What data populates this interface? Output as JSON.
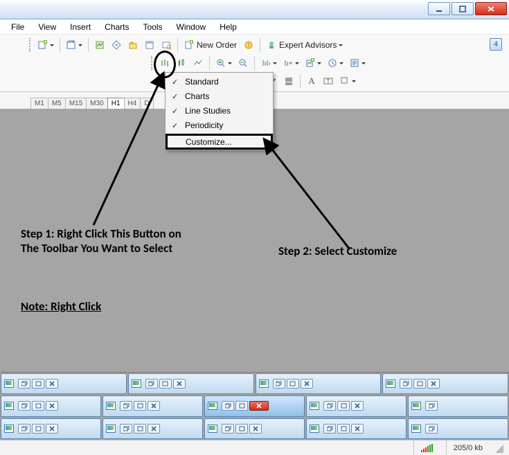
{
  "window_controls": {
    "minimize": "–",
    "maximize": "▢",
    "close": "✕"
  },
  "menu": [
    "File",
    "View",
    "Insert",
    "Charts",
    "Tools",
    "Window",
    "Help"
  ],
  "toolbar1": {
    "new_order": "New Order",
    "expert_advisors": "Expert Advisors",
    "badge": "4"
  },
  "context_menu": {
    "items": [
      {
        "label": "Standard",
        "checked": true
      },
      {
        "label": "Charts",
        "checked": true
      },
      {
        "label": "Line Studies",
        "checked": true
      },
      {
        "label": "Periodicity",
        "checked": true
      }
    ],
    "customize": "Customize..."
  },
  "period_tabs": [
    "M1",
    "M5",
    "M15",
    "M30",
    "H1",
    "H4",
    "D"
  ],
  "period_active": "H1",
  "annotations": {
    "step1": "Step 1: Right Click This Button on The Toolbar You Want to Select",
    "step2": "Step 2: Select Customize",
    "note": "Note: Right Click"
  },
  "status": {
    "kb": "205/0 kb"
  }
}
